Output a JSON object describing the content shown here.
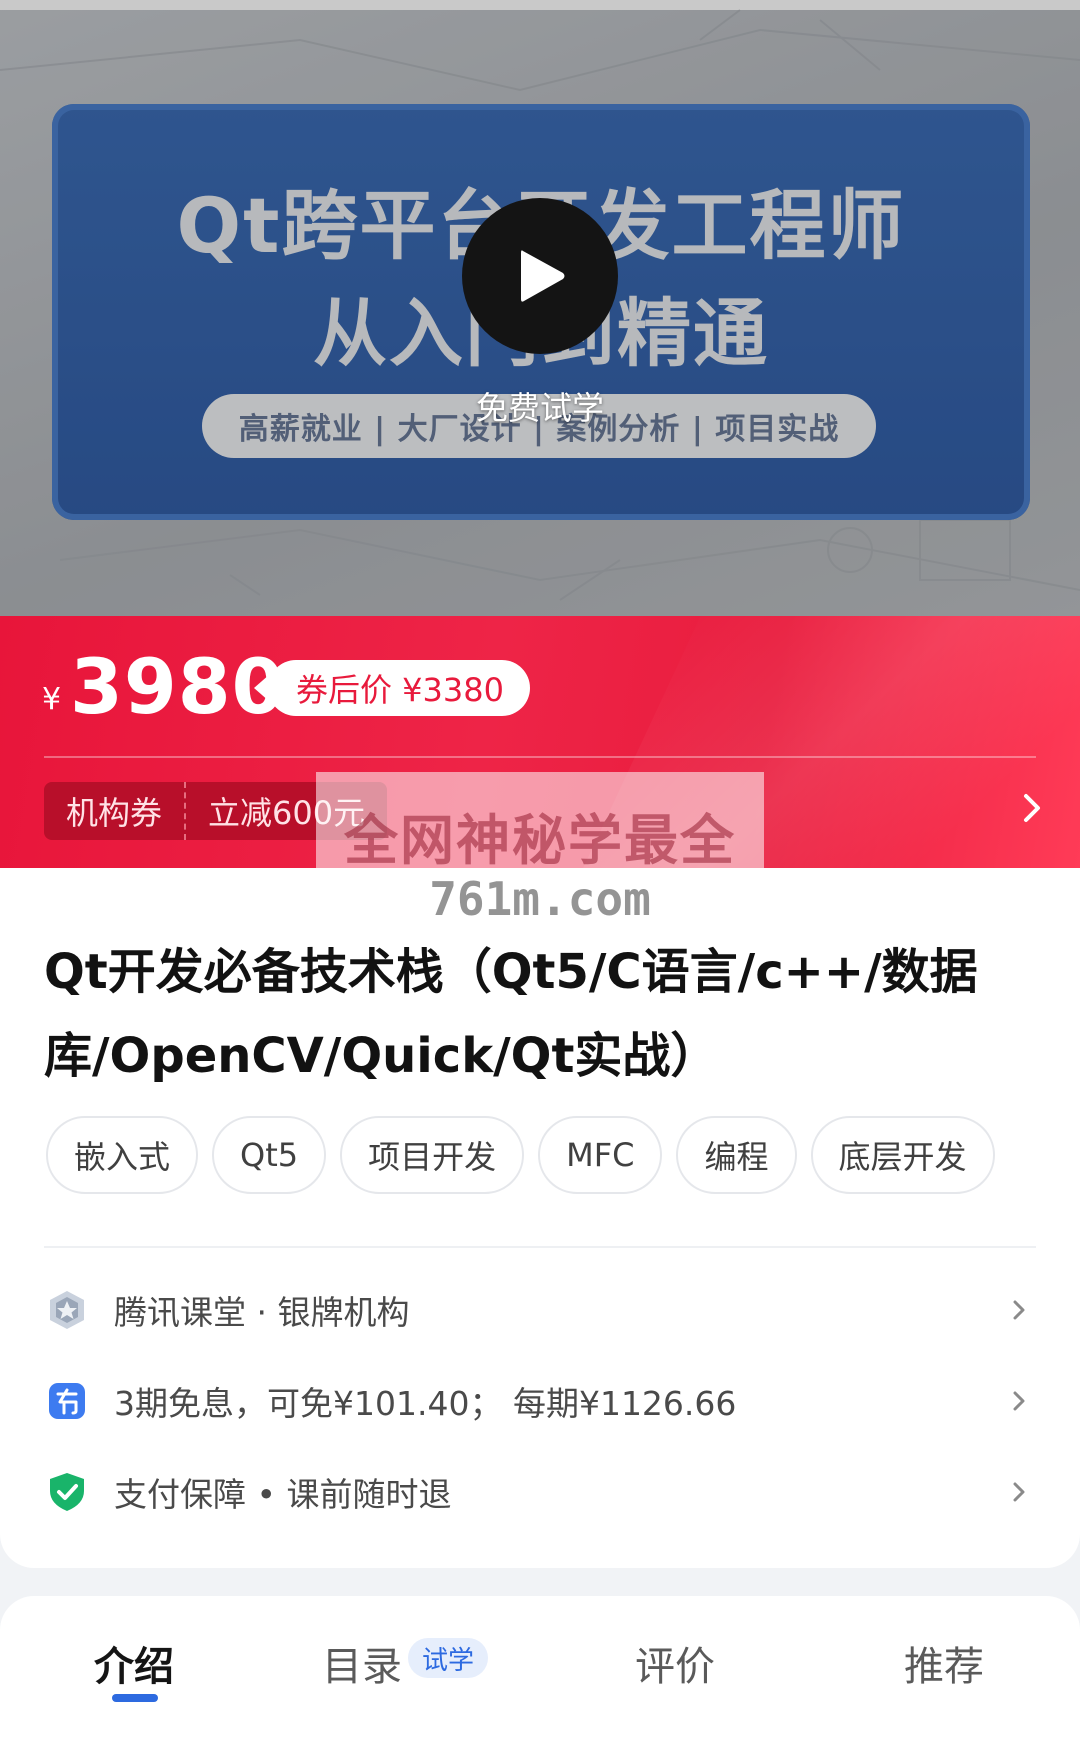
{
  "video": {
    "poster_line1": "Qt跨平台开发工程师",
    "poster_line2": "从入门到精通",
    "poster_pill": "高薪就业 | 大厂设计 | 案例分析 | 项目实战",
    "play_icon": "play-icon",
    "free_trial_label": "免费试学"
  },
  "price": {
    "currency": "¥",
    "amount": "3980",
    "coupon_price": "券后价 ¥3380",
    "coupon_tag": "机构券",
    "coupon_amount": "立减600元",
    "chevron_icon": "chevron-right-icon"
  },
  "course": {
    "title": "Qt开发必备技术栈（Qt5/C语言/c++/数据库/OpenCV/Quick/Qt实战）",
    "tags": [
      "嵌入式",
      "Qt5",
      "项目开发",
      "MFC",
      "编程",
      "底层开发"
    ]
  },
  "info_rows": [
    {
      "icon": "silver-badge-icon",
      "text": "腾讯课堂 · 银牌机构"
    },
    {
      "icon": "installment-icon",
      "text": "3期免息，可免¥101.40；  每期¥1126.66"
    },
    {
      "icon": "shield-check-icon",
      "text": "支付保障 • 课前随时退"
    }
  ],
  "tabs": {
    "items": [
      "介绍",
      "目录",
      "评价",
      "推荐"
    ],
    "active": "介绍",
    "trial_badge": "试学"
  },
  "watermark": {
    "line1": "全网神秘学最全",
    "line2": "761m.com"
  },
  "colors": {
    "price_red": "#e8153a",
    "accent_blue": "#2d6ae0",
    "shield_green": "#19b46a"
  }
}
